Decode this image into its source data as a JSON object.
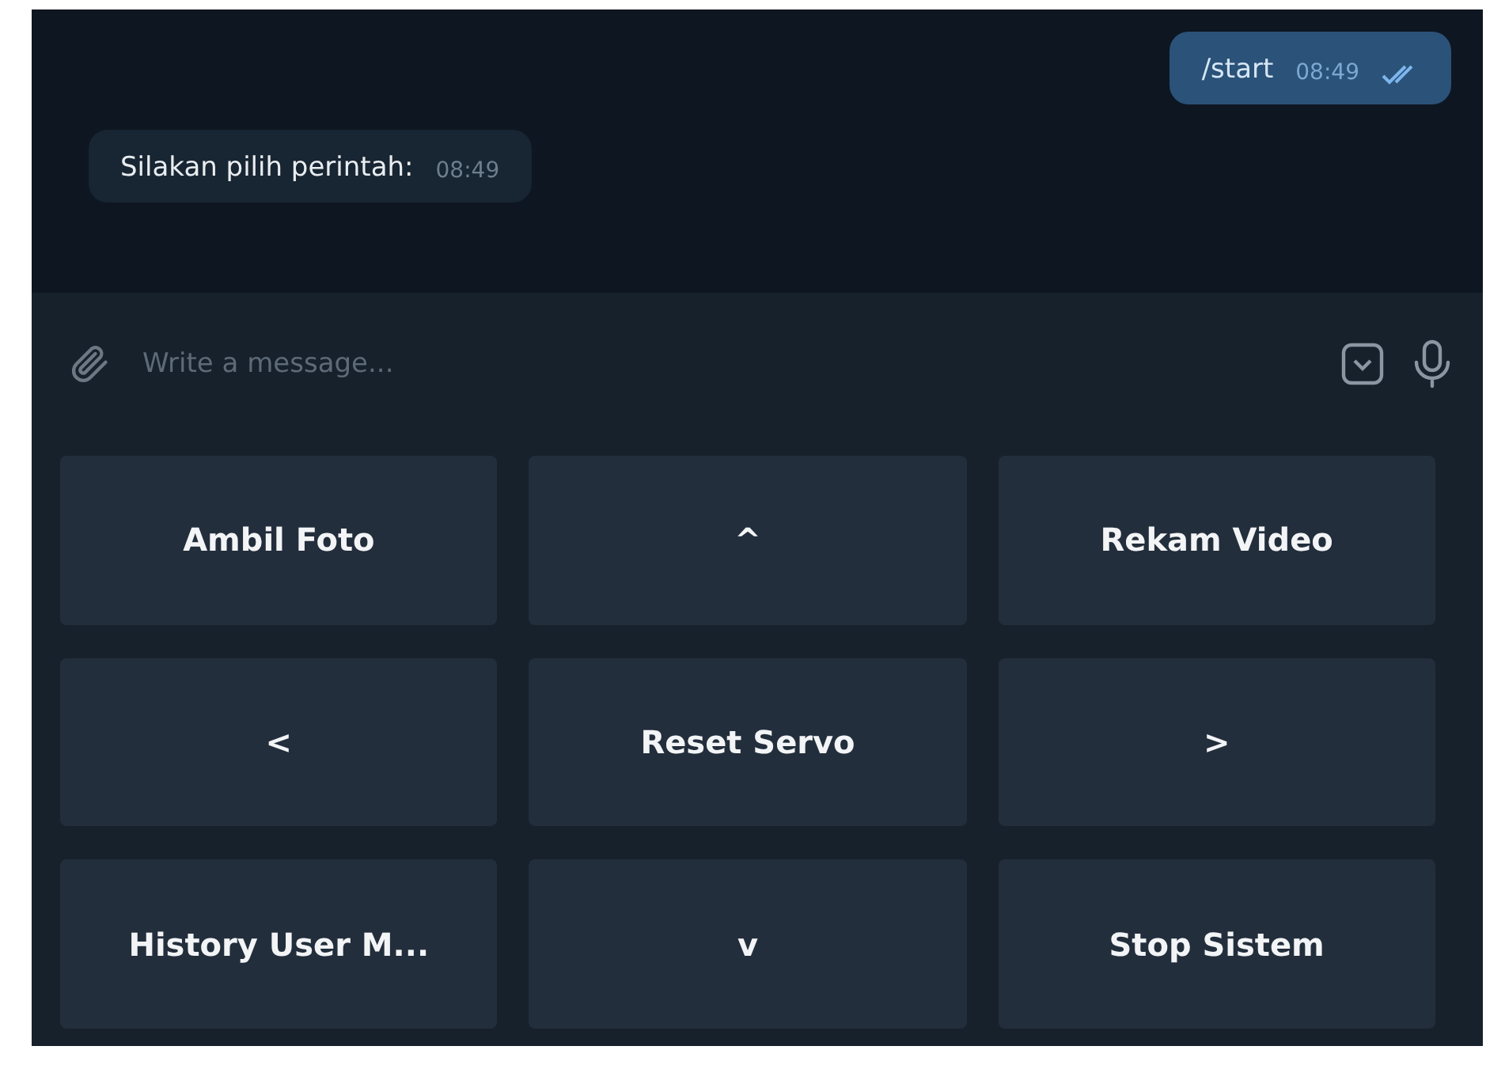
{
  "messages": [
    {
      "kind": "outgoing",
      "text": "/start",
      "time": "08:49",
      "read": true
    },
    {
      "kind": "incoming",
      "text": "Silakan pilih perintah:",
      "time": "08:49"
    }
  ],
  "composer": {
    "placeholder": "Write a message..."
  },
  "keyboard": [
    [
      "Ambil Foto",
      "^",
      "Rekam Video"
    ],
    [
      "<",
      "Reset Servo",
      ">"
    ],
    [
      "History User M...",
      "v",
      "Stop Sistem"
    ]
  ]
}
